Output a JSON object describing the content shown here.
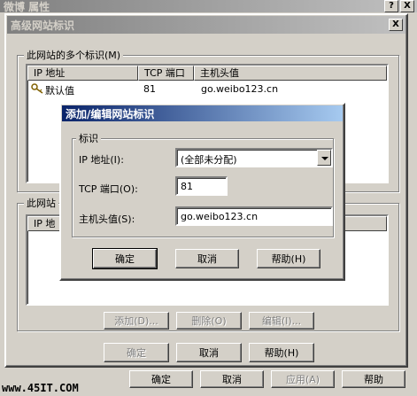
{
  "outer_window": {
    "title": "微博 属性",
    "help_button": "?",
    "close_button": "X",
    "buttons": [
      "确定",
      "取消",
      "应用(A)",
      "帮助"
    ]
  },
  "adv_dialog": {
    "title": "高级网站标识",
    "close_button": "X",
    "group1_label": "此网站的多个标识(M)",
    "columns": [
      "IP 地址",
      "TCP 端口",
      "主机头值"
    ],
    "rows": [
      {
        "ip": "默认值",
        "port": "81",
        "host": "go.weibo123.cn"
      }
    ],
    "group2_label": "此网站",
    "group2_column": "IP 地",
    "buttons": {
      "add": "添加(D)...",
      "remove": "删除(O)",
      "edit": "编辑(I)..."
    },
    "ok": "确定",
    "cancel": "取消",
    "help": "帮助(H)"
  },
  "edit_dialog": {
    "title": "添加/编辑网站标识",
    "group_label": "标识",
    "ip_label": "IP 地址(I):",
    "ip_value": "(全部未分配)",
    "port_label": "TCP 端口(O):",
    "port_value": "81",
    "host_label": "主机头值(S):",
    "host_value": "go.weibo123.cn",
    "ok": "确定",
    "cancel": "取消",
    "help": "帮助(H)"
  },
  "watermark": "www.45IT.COM"
}
